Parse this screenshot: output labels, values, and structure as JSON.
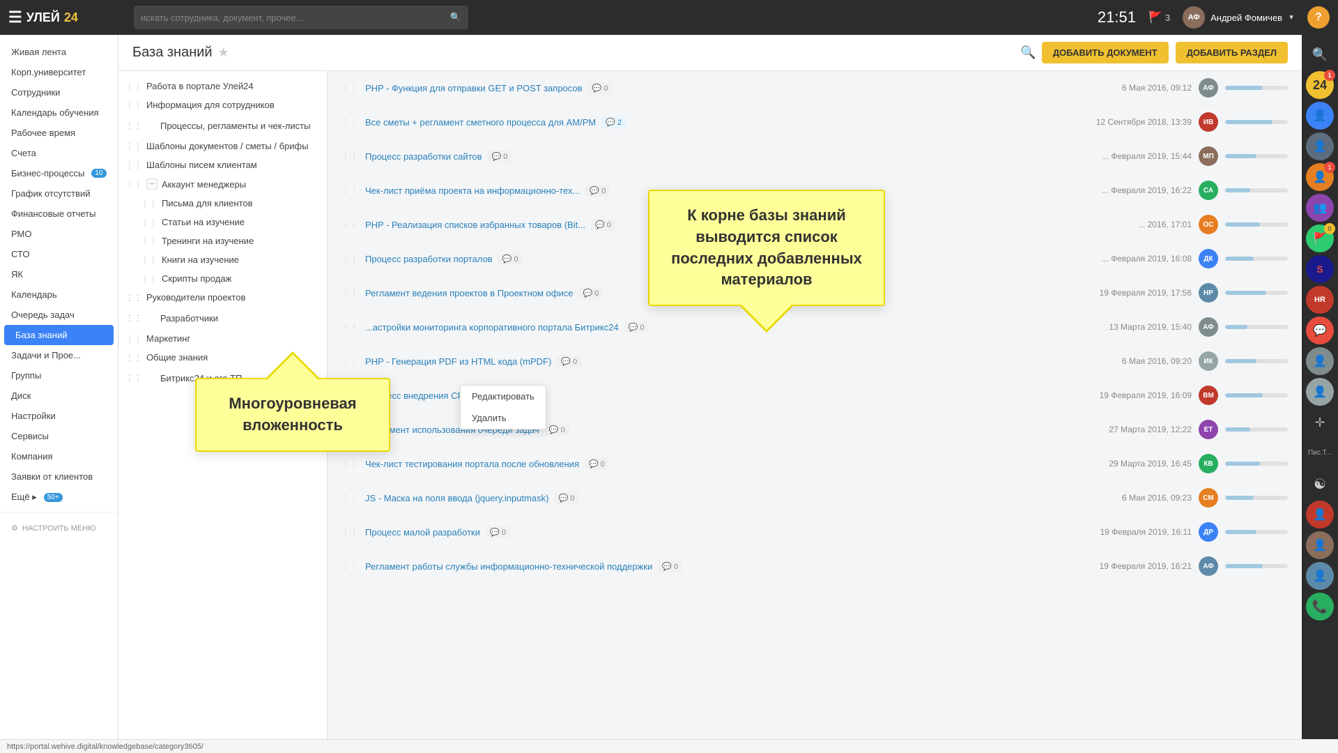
{
  "app": {
    "logo_text": "УЛЕЙ",
    "logo_num": "24",
    "search_placeholder": "искать сотрудника, документ, прочее...",
    "time": "21:51",
    "notif": "3",
    "user_name": "Андрей Фомичев",
    "help": "?"
  },
  "sidebar": {
    "items": [
      {
        "label": "Живая лента",
        "active": false
      },
      {
        "label": "Корп.университет",
        "active": false
      },
      {
        "label": "Сотрудники",
        "active": false
      },
      {
        "label": "Календарь обучения",
        "active": false
      },
      {
        "label": "Рабочее время",
        "active": false
      },
      {
        "label": "Счета",
        "active": false
      },
      {
        "label": "Бизнес-процессы",
        "badge": "10",
        "active": false
      },
      {
        "label": "График отсутствий",
        "active": false
      },
      {
        "label": "Финансовые отчеты",
        "active": false
      },
      {
        "label": "РМО",
        "active": false
      },
      {
        "label": "СТО",
        "active": false
      },
      {
        "label": "ЯК",
        "active": false
      },
      {
        "label": "Календарь",
        "active": false
      },
      {
        "label": "Очередь задач",
        "active": false
      },
      {
        "label": "База знаний",
        "active": true
      },
      {
        "label": "Задачи и Прое...",
        "active": false
      },
      {
        "label": "Группы",
        "active": false
      },
      {
        "label": "Диск",
        "active": false
      },
      {
        "label": "Настройки",
        "active": false
      },
      {
        "label": "Сервисы",
        "active": false
      },
      {
        "label": "Компания",
        "active": false
      },
      {
        "label": "Заявки от клиентов",
        "active": false
      },
      {
        "label": "Ещё ▸",
        "badge": "50+",
        "active": false
      }
    ],
    "configure_label": "НАСТРОИТЬ МЕНЮ"
  },
  "page": {
    "title": "База знаний",
    "btn_add_doc": "ДОБАВИТЬ ДОКУМЕНТ",
    "btn_add_section": "ДОБАВИТЬ РАЗДЕЛ"
  },
  "tree": {
    "items": [
      {
        "label": "Работа в портале Улей24",
        "indent": 0,
        "expandable": false
      },
      {
        "label": "Информация для сотрудников",
        "indent": 0,
        "expandable": false
      },
      {
        "label": "Процессы, регламенты и чек-листы",
        "indent": 0,
        "expandable": false,
        "has_add": true
      },
      {
        "label": "Шаблоны документов / сметы / брифы",
        "indent": 0,
        "expandable": false
      },
      {
        "label": "Шаблоны писем клиентам",
        "indent": 0,
        "expandable": false
      },
      {
        "label": "Аккаунт менеджеры",
        "indent": 0,
        "expandable": true,
        "expanded": true
      },
      {
        "label": "Письма для клиентов",
        "indent": 1,
        "expandable": false
      },
      {
        "label": "Статьи на изучение",
        "indent": 1,
        "expandable": false
      },
      {
        "label": "Тренинги на изучение",
        "indent": 1,
        "expandable": false
      },
      {
        "label": "Книги на изучение",
        "indent": 1,
        "expandable": false
      },
      {
        "label": "Скрипты продаж",
        "indent": 1,
        "expandable": false
      },
      {
        "label": "Руководители проектов",
        "indent": 0,
        "expandable": false
      },
      {
        "label": "Разработчики",
        "indent": 0,
        "expandable": false,
        "has_add": true
      },
      {
        "label": "Маркетинг",
        "indent": 0,
        "expandable": false
      },
      {
        "label": "Общие знания",
        "indent": 0,
        "expandable": false
      },
      {
        "label": "Битрикс24 и его ТП",
        "indent": 0,
        "expandable": false,
        "has_add": true
      }
    ]
  },
  "context_menu": {
    "items": [
      {
        "label": "Редактировать"
      },
      {
        "label": "Удалить"
      }
    ]
  },
  "documents": [
    {
      "title": "PHP - Функция для отправки GET и POST запросов",
      "comments": "0",
      "date": "6 Мая 2016, 09:12",
      "avatar_color": "#7f8c8d",
      "progress": 60
    },
    {
      "title": "Все сметы + регламент сметного процесса для АМ/РМ",
      "comments": "2",
      "date": "12 Сентября 2018, 13:39",
      "avatar_color": "#c0392b",
      "progress": 75,
      "comment_highlight": true
    },
    {
      "title": "Процесс разработки сайтов",
      "comments": "0",
      "date": "... Февраля 2019, 15:44",
      "avatar_color": "#8b6d5c",
      "progress": 50
    },
    {
      "title": "Чек-лист приёма проекта на информационно-тех...",
      "comments": "0",
      "date": "... Февраля 2019, 16:22",
      "avatar_color": "#27ae60",
      "progress": 40
    },
    {
      "title": "PHP - Реализация списков избранных товаров (Bit...",
      "comments": "0",
      "date": "... 2016, 17:01",
      "avatar_color": "#e67e22",
      "progress": 55
    },
    {
      "title": "Процесс разработки порталов",
      "comments": "0",
      "date": "... Февраля 2019, 16:08",
      "avatar_color": "#3b82f6",
      "progress": 45
    },
    {
      "title": "Регламент ведения проектов в Проектном офисе",
      "comments": "0",
      "date": "19 Февраля 2019, 17:56",
      "avatar_color": "#5d8aa8",
      "progress": 65
    },
    {
      "title": "...астройки мониторинга корпоративного портала Битрикс24",
      "comments": "0",
      "date": "13 Марта 2019, 15:40",
      "avatar_color": "#7f8c8d",
      "progress": 35
    },
    {
      "title": "PHP - Генерация PDF из HTML кода (mPDF)",
      "comments": "0",
      "date": "6 Мая 2016, 09:20",
      "avatar_color": "#95a5a6",
      "progress": 50
    },
    {
      "title": "Процесс внедрения CRM",
      "comments": "0",
      "date": "19 Февраля 2019, 16:09",
      "avatar_color": "#c0392b",
      "progress": 60
    },
    {
      "title": "Регламент использования очереди задач",
      "comments": "0",
      "date": "27 Марта 2019, 12:22",
      "avatar_color": "#8e44ad",
      "progress": 40
    },
    {
      "title": "Чек-лист тестирования портала после обновления",
      "comments": "0",
      "date": "29 Марта 2019, 16:45",
      "avatar_color": "#27ae60",
      "progress": 55
    },
    {
      "title": "JS - Маска на поля ввода (jquery.inputmask)",
      "comments": "0",
      "date": "6 Мая 2016, 09:23",
      "avatar_color": "#e67e22",
      "progress": 45
    },
    {
      "title": "Процесс малой разработки",
      "comments": "0",
      "date": "19 Февраля 2019, 16:11",
      "avatar_color": "#3b82f6",
      "progress": 50
    },
    {
      "title": "Регламент работы службы информационно-технической поддержки",
      "comments": "0",
      "date": "19 Февраля 2019, 16:21",
      "avatar_color": "#5d8aa8",
      "progress": 60
    }
  ],
  "callouts": {
    "left_text": "Многоуровневая вложенность",
    "right_text": "К корне базы знаний выводится список последних добавленных материалов"
  },
  "url_bar": "https://portal.wehive.digital/knowledgebase/category3605/"
}
